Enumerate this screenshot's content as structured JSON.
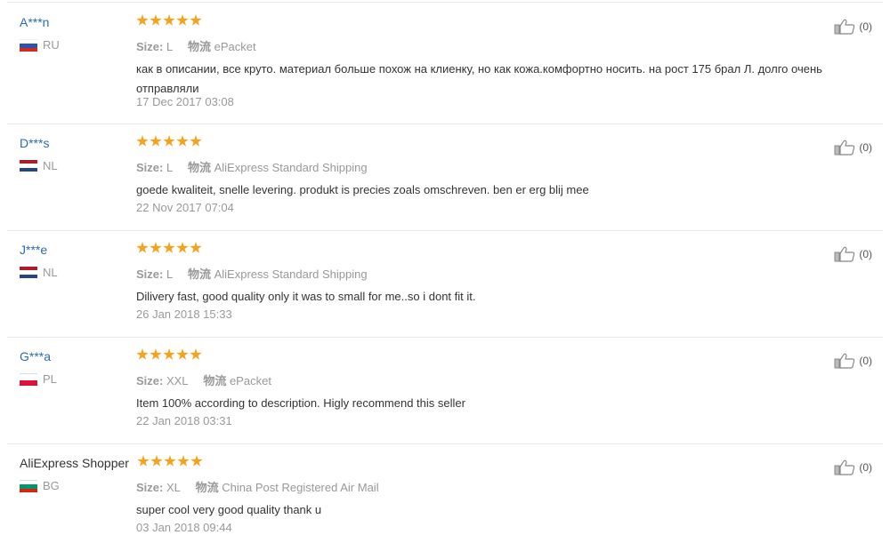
{
  "reviews": [
    {
      "user": "A***n",
      "country": "RU",
      "flag_colors": [
        "#ffffff",
        "#2b52b5",
        "#d52b1e"
      ],
      "rating": 5,
      "size_label": "Size:",
      "size": "L",
      "shipping_label": "物流",
      "shipping": "ePacket",
      "text": "как в описании, все круто. материал больше похож на клиенку, но как кожа.комфортно носить. на рост 175 брал Л. долго очень отправляли",
      "date": "17 Dec 2017 03:08",
      "helpful_count": "(0)"
    },
    {
      "user": "D***s",
      "country": "NL",
      "flag_colors": [
        "#ae1c28",
        "#ffffff",
        "#21468b"
      ],
      "rating": 5,
      "size_label": "Size:",
      "size": "L",
      "shipping_label": "物流",
      "shipping": "AliExpress Standard Shipping",
      "text": "goede kwaliteit, snelle levering. produkt is precies zoals omschreven. ben er erg blij mee",
      "date": "22 Nov 2017 07:04",
      "helpful_count": "(0)"
    },
    {
      "user": "J***e",
      "country": "NL",
      "flag_colors": [
        "#ae1c28",
        "#ffffff",
        "#21468b"
      ],
      "rating": 5,
      "size_label": "Size:",
      "size": "L",
      "shipping_label": "物流",
      "shipping": "AliExpress Standard Shipping",
      "text": "Dilivery fast, good quality only it was to small for me..so i dont fit it.",
      "date": "26 Jan 2018 15:33",
      "helpful_count": "(0)"
    },
    {
      "user": "G***a",
      "country": "PL",
      "flag_colors": [
        "#ffffff",
        "#dc143c"
      ],
      "rating": 5,
      "size_label": "Size:",
      "size": "XXL",
      "shipping_label": "物流",
      "shipping": "ePacket",
      "text": "Item 100% according to description. Higly recommend this seller",
      "date": "22 Jan 2018 03:31",
      "helpful_count": "(0)"
    },
    {
      "user": "AliExpress Shopper",
      "country": "BG",
      "flag_colors": [
        "#ffffff",
        "#00966e",
        "#d62612"
      ],
      "rating": 5,
      "size_label": "Size:",
      "size": "XL",
      "shipping_label": "物流",
      "shipping": "China Post Registered Air Mail",
      "text": "super cool very good quality thank u",
      "date": "03 Jan 2018 09:44",
      "helpful_count": "(0)"
    }
  ],
  "icons": {
    "star": "star-icon",
    "helpful": "thumbs-up-icon"
  },
  "colors": {
    "star": "#f7a21a",
    "username_link": "#2b6cb0",
    "muted": "#999999"
  }
}
